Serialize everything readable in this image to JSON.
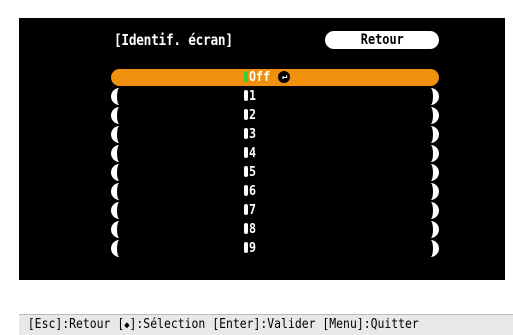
{
  "menu": {
    "title": "[Identif. écran]",
    "back_button": "Retour"
  },
  "options": [
    {
      "label": "Off",
      "selected": true
    },
    {
      "label": "1",
      "selected": false
    },
    {
      "label": "2",
      "selected": false
    },
    {
      "label": "3",
      "selected": false
    },
    {
      "label": "4",
      "selected": false
    },
    {
      "label": "5",
      "selected": false
    },
    {
      "label": "6",
      "selected": false
    },
    {
      "label": "7",
      "selected": false
    },
    {
      "label": "8",
      "selected": false
    },
    {
      "label": "9",
      "selected": false
    }
  ],
  "selected_marker_icon": "enter-icon",
  "help": {
    "esc": "[Esc]:Retour",
    "select_open": "[",
    "select_icon": "◆",
    "select_close": "]:Sélection",
    "enter": "[Enter]:Valider",
    "menu": "[Menu]:Quitter"
  },
  "colors": {
    "selected": "#f0900c",
    "radio_selected": "#33d233",
    "screen_bg": "#000000"
  }
}
